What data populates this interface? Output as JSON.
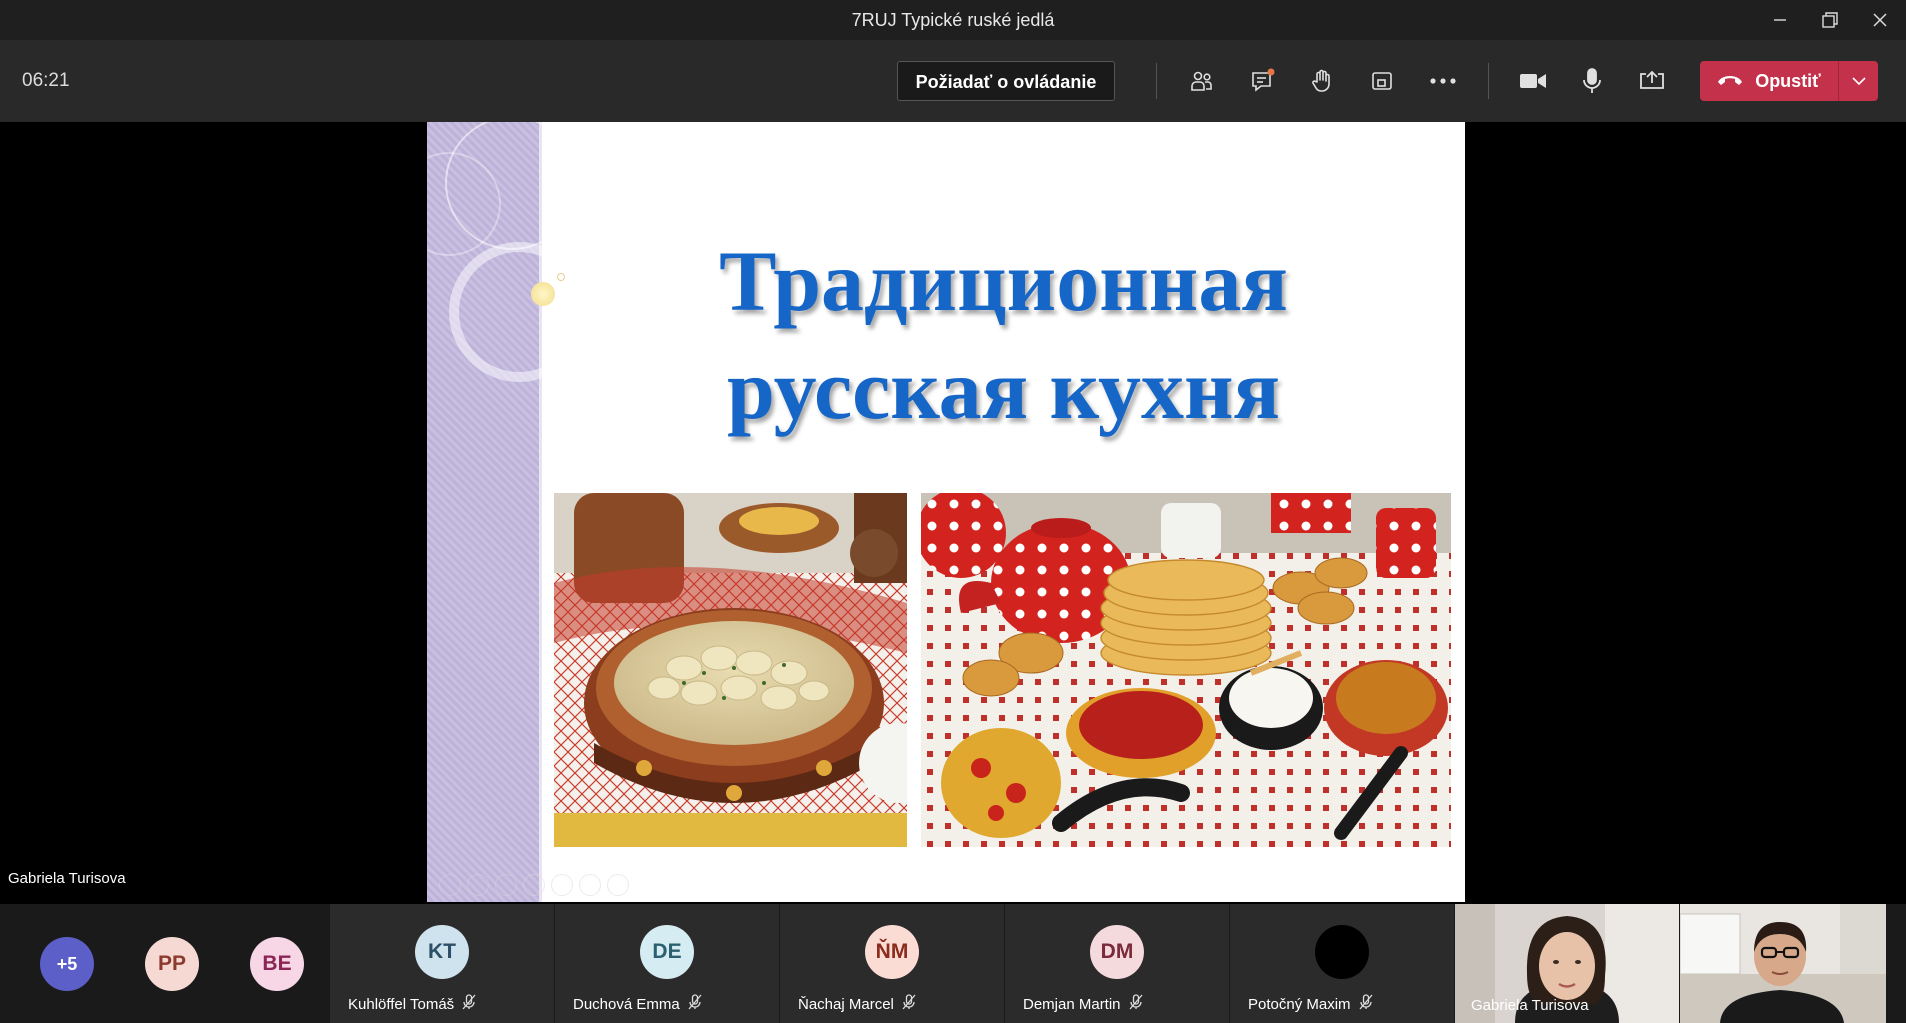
{
  "window": {
    "title": "7RUJ Typické ruské jedlá"
  },
  "toolbar": {
    "timer": "06:21",
    "request_control_label": "Požiadať o ovládanie",
    "leave_label": "Opustiť",
    "colors": {
      "leave": "#c4314b",
      "badge": "#e8754a"
    }
  },
  "slide": {
    "title_line1": "Традиционная",
    "title_line2": "русская кухня",
    "title_color": "#1666c8"
  },
  "stage": {
    "presenter_name": "Gabriela Turisova"
  },
  "gallery": {
    "overflow_count": "+5",
    "small_avatars": [
      {
        "initials": "PP",
        "bg": "#f6d9d3",
        "fg": "#8a3b2e"
      },
      {
        "initials": "BE",
        "bg": "#f7d6e6",
        "fg": "#8b2556"
      }
    ],
    "participants": [
      {
        "initials": "KT",
        "name": "Kuhlöffel Tomáš",
        "bg": "#cfe3ee",
        "fg": "#2c4e66"
      },
      {
        "initials": "DE",
        "name": "Duchová Emma",
        "bg": "#d5ecf2",
        "fg": "#2b6070"
      },
      {
        "initials": "ŇM",
        "name": "Ňachaj Marcel",
        "bg": "#fbdcd5",
        "fg": "#8a2b1c"
      },
      {
        "initials": "DM",
        "name": "Demjan Martin",
        "bg": "#f4d9dd",
        "fg": "#7a2a38"
      },
      {
        "initials": "",
        "name": "Potočný Maxim",
        "bg": "#000000",
        "fg": "#ffffff"
      }
    ],
    "video_participant": "Gabriela Turisova"
  }
}
